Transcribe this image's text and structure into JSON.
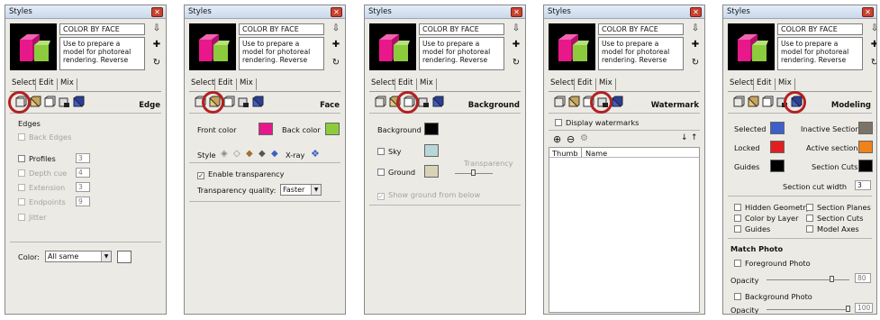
{
  "panels": [
    {
      "title": "Styles",
      "style_name": "COLOR BY FACE",
      "style_desc": "Use to prepare a model for photoreal rendering.  Reverse",
      "tabs": [
        "Select",
        "Edit",
        "Mix"
      ],
      "section": "Edge",
      "edge": {
        "heading": "Edges",
        "back_edges": "Back Edges",
        "profiles": "Profiles",
        "profiles_val": "3",
        "depth_cue": "Depth cue",
        "depth_val": "4",
        "extension": "Extension",
        "extension_val": "3",
        "endpoints": "Endpoints",
        "endpoints_val": "9",
        "jitter": "Jitter",
        "color_label": "Color:",
        "color_value": "All same"
      }
    },
    {
      "title": "Styles",
      "style_name": "COLOR BY FACE",
      "style_desc": "Use to prepare a model for photoreal rendering.  Reverse",
      "tabs": [
        "Select",
        "Edit",
        "Mix"
      ],
      "section": "Face",
      "face": {
        "front_color": "Front color",
        "back_color": "Back color",
        "style_label": "Style",
        "xray": "X-ray",
        "enable_transparency": "Enable transparency",
        "quality_label": "Transparency quality:",
        "quality_value": "Faster"
      }
    },
    {
      "title": "Styles",
      "style_name": "COLOR BY FACE",
      "style_desc": "Use to prepare a model for photoreal rendering.  Reverse",
      "tabs": [
        "Select",
        "Edit",
        "Mix"
      ],
      "section": "Background",
      "bg": {
        "background": "Background",
        "sky": "Sky",
        "ground": "Ground",
        "transparency": "Transparency",
        "show_ground": "Show ground from below"
      }
    },
    {
      "title": "Styles",
      "style_name": "COLOR BY FACE",
      "style_desc": "Use to prepare a model for photoreal rendering.  Reverse",
      "tabs": [
        "Select",
        "Edit",
        "Mix"
      ],
      "section": "Watermark",
      "wm": {
        "display": "Display watermarks",
        "col_thumb": "Thumb",
        "col_name": "Name"
      }
    },
    {
      "title": "Styles",
      "style_name": "COLOR BY FACE",
      "style_desc": "Use to prepare a model for photoreal rendering.  Reverse",
      "tabs": [
        "Select",
        "Edit",
        "Mix"
      ],
      "section": "Modeling",
      "model": {
        "selected": "Selected",
        "inactive_section": "Inactive Section",
        "locked": "Locked",
        "active_section": "Active section",
        "guides": "Guides",
        "section_cuts": "Section Cuts",
        "cut_width_label": "Section cut width",
        "cut_width_val": "3",
        "hidden_geometry": "Hidden Geometry",
        "section_planes": "Section Planes",
        "color_by_layer": "Color by Layer",
        "section_cuts_cb": "Section Cuts",
        "guides_cb": "Guides",
        "model_axes": "Model Axes",
        "match_photo": "Match Photo",
        "foreground_photo": "Foreground Photo",
        "opacity": "Opacity",
        "fg_opacity_val": "80",
        "background_photo": "Background Photo",
        "bg_opacity_val": "100"
      }
    }
  ],
  "colors": {
    "front_color": "#e8188a",
    "back_color": "#8ccb3c",
    "background": "#000000",
    "sky": "#b9d7d7",
    "ground": "#d8d2b8",
    "selected": "#3f5fc8",
    "inactive_section": "#7b7366",
    "locked": "#e02020",
    "active_section": "#f0821a",
    "guides": "#000000",
    "section_cuts": "#000000",
    "highlight_ring": "#b22222"
  }
}
